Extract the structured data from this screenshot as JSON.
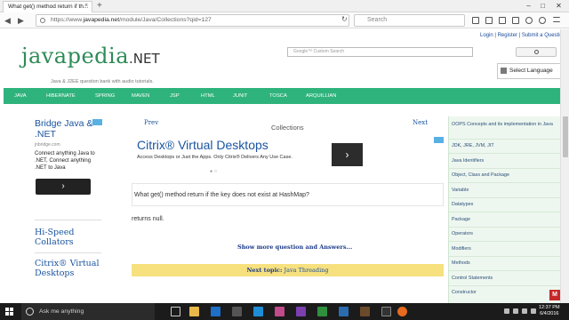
{
  "browser": {
    "tab_title": "What get() method return if th...",
    "tab_close": "×",
    "new_tab": "+",
    "url_prefix": "https://www.",
    "url_host": "javapedia.net",
    "url_path": "/module/Java/Collections?qid=127",
    "search_placeholder": "Search",
    "window_min": "–",
    "window_max": "□",
    "window_close": "✕"
  },
  "site": {
    "logo_main": "javapedia",
    "logo_net": ".NET",
    "tagline": "Java & J2EE question bank with audio tutorials.",
    "top_links": [
      "Login",
      "Register",
      "Submit a Question"
    ],
    "google_placeholder": "Google™ Custom Search",
    "language_select": "Select Language"
  },
  "menu": [
    "JAVA",
    "HIBERNATE",
    "SPRING",
    "MAVEN",
    "JSP",
    "HTML",
    "JUNIT",
    "TOSCA",
    "ARQUILLIAN"
  ],
  "ad_left": {
    "title": "Bridge Java & .NET",
    "domain": "jnbridge.com",
    "text": "Connect anything Java to .NET, Connect anything .NET to Java",
    "arrow": "›"
  },
  "side_links": [
    "Hi-Speed Collators",
    "Citrix® Virtual Desktops"
  ],
  "content": {
    "prev": "Prev",
    "next": "Next",
    "section": "Collections",
    "question": "What get() method return if the key does not exist at HashMap?",
    "answer": "returns null.",
    "show_more": "Show more question and Answers...",
    "next_topic_label": "Next topic:",
    "next_topic_link": "Java Threading"
  },
  "ad_citrix": {
    "title": "Citrix® Virtual Desktops",
    "text": "Access Desktops or Just the Apps. Only Citrix® Delivers Any Use Case.",
    "arrow": "›",
    "dots": "●○"
  },
  "right_nav": [
    "OOPS Concepts and its implementation in Java",
    "JDK, JRE, JVM, JIT",
    "Java Identifiers",
    "Object, Class and Package",
    "Variable",
    "Datatypes",
    "Package",
    "Operators",
    "Modifiers",
    "Methods",
    "Control Statements",
    "Constructor"
  ],
  "taskbar": {
    "search_text": "Ask me anything",
    "time": "12:37 PM",
    "date": "6/4/2016"
  },
  "colors": {
    "brand_green": "#2fb37c",
    "link_blue": "#1a55a0",
    "next_topic_bg": "#f7e07e"
  }
}
